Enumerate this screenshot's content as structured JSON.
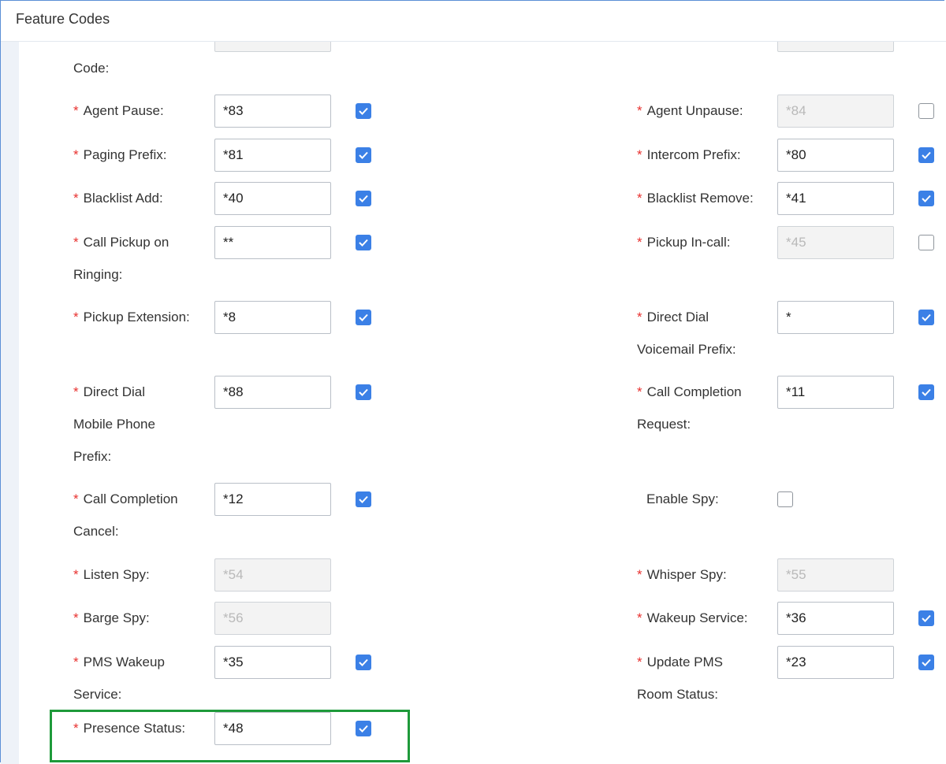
{
  "panel": {
    "title": "Feature Codes"
  },
  "fields": [
    {
      "label": [
        "Code:"
      ],
      "value": "",
      "disabled": true,
      "checked": null,
      "required": false
    },
    {
      "label": [
        "Agent Pause:"
      ],
      "value": "*83",
      "disabled": false,
      "checked": true,
      "required": true
    },
    {
      "label": [
        "Agent Unpause:"
      ],
      "value": "*84",
      "disabled": true,
      "checked": false,
      "required": true
    },
    {
      "label": [
        "Paging Prefix:"
      ],
      "value": "*81",
      "disabled": false,
      "checked": true,
      "required": true
    },
    {
      "label": [
        "Intercom Prefix:"
      ],
      "value": "*80",
      "disabled": false,
      "checked": true,
      "required": true
    },
    {
      "label": [
        "Blacklist Add:"
      ],
      "value": "*40",
      "disabled": false,
      "checked": true,
      "required": true
    },
    {
      "label": [
        "Blacklist Remove:"
      ],
      "value": "*41",
      "disabled": false,
      "checked": true,
      "required": true
    },
    {
      "label": [
        "Call Pickup on",
        "Ringing:"
      ],
      "value": "**",
      "disabled": false,
      "checked": true,
      "required": true
    },
    {
      "label": [
        "Pickup In-call:"
      ],
      "value": "*45",
      "disabled": true,
      "checked": false,
      "required": true
    },
    {
      "label": [
        "Pickup Extension:"
      ],
      "value": "*8",
      "disabled": false,
      "checked": true,
      "required": true
    },
    {
      "label": [
        "Direct Dial",
        "Voicemail Prefix:"
      ],
      "value": "*",
      "disabled": false,
      "checked": true,
      "required": true
    },
    {
      "label": [
        "Direct Dial",
        "Mobile Phone",
        "Prefix:"
      ],
      "value": "*88",
      "disabled": false,
      "checked": true,
      "required": true
    },
    {
      "label": [
        "Call Completion",
        "Request:"
      ],
      "value": "*11",
      "disabled": false,
      "checked": true,
      "required": true
    },
    {
      "label": [
        "Call Completion",
        "Cancel:"
      ],
      "value": "*12",
      "disabled": false,
      "checked": true,
      "required": true
    },
    {
      "label": [
        "Enable Spy:"
      ],
      "value": null,
      "disabled": false,
      "checked": false,
      "required": false
    },
    {
      "label": [
        "Listen Spy:"
      ],
      "value": "*54",
      "disabled": true,
      "checked": null,
      "required": true
    },
    {
      "label": [
        "Whisper Spy:"
      ],
      "value": "*55",
      "disabled": true,
      "checked": null,
      "required": true
    },
    {
      "label": [
        "Barge Spy:"
      ],
      "value": "*56",
      "disabled": true,
      "checked": null,
      "required": true
    },
    {
      "label": [
        "Wakeup Service:"
      ],
      "value": "*36",
      "disabled": false,
      "checked": true,
      "required": true
    },
    {
      "label": [
        "PMS Wakeup",
        "Service:"
      ],
      "value": "*35",
      "disabled": false,
      "checked": true,
      "required": true
    },
    {
      "label": [
        "Update PMS",
        "Room Status:"
      ],
      "value": "*23",
      "disabled": false,
      "checked": true,
      "required": true
    },
    {
      "label": [
        "Presence Status:"
      ],
      "value": "*48",
      "disabled": false,
      "checked": true,
      "required": true
    }
  ],
  "colors": {
    "required_star": "#e8312f",
    "checkbox_checked": "#3b80e6",
    "highlight": "#1e9a3a"
  }
}
